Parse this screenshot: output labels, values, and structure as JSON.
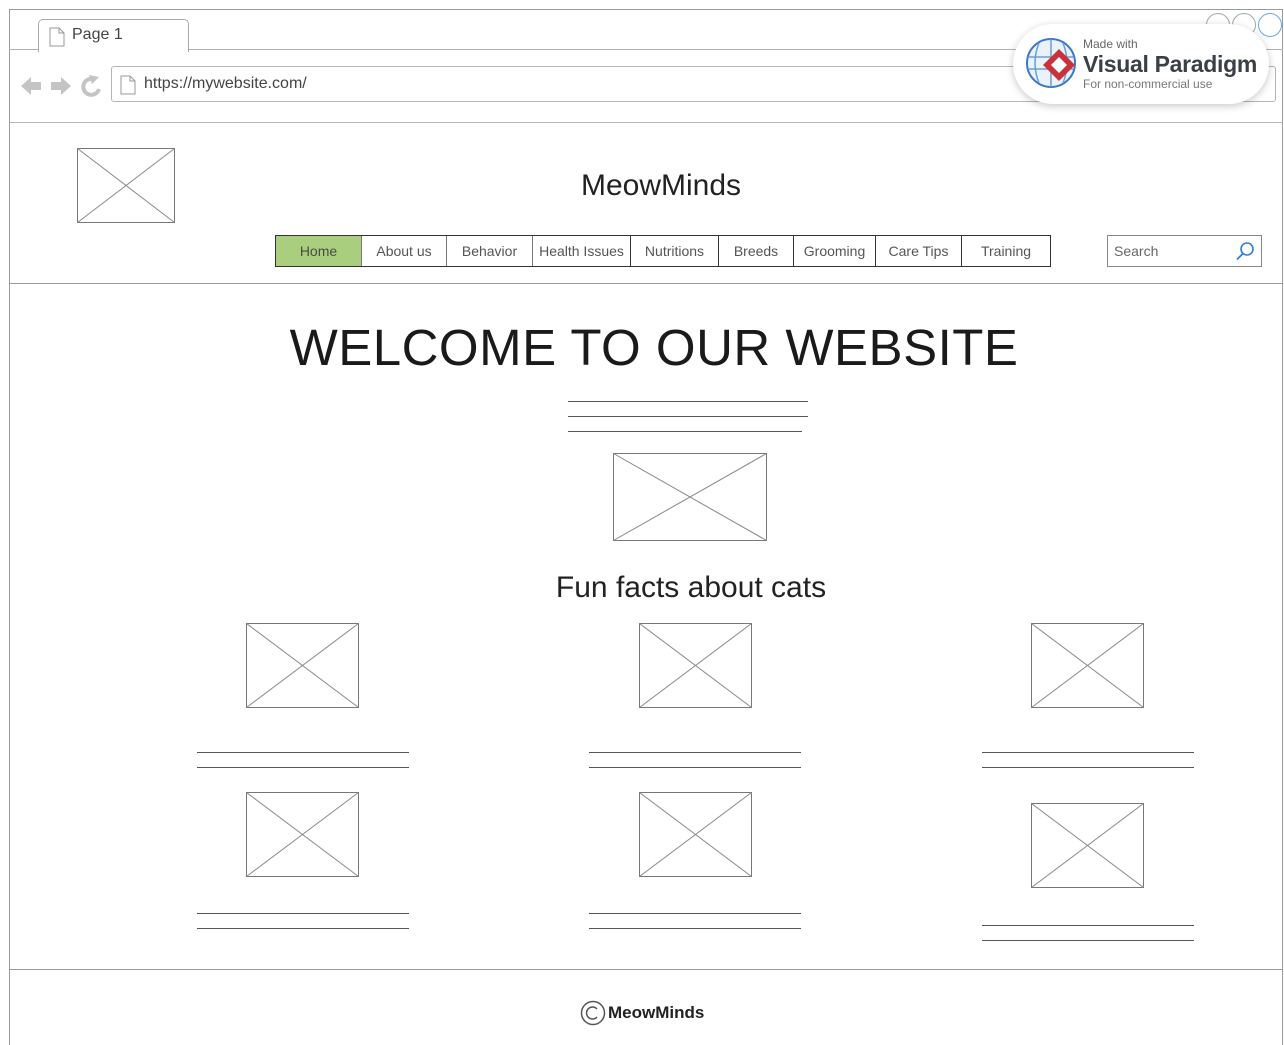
{
  "browser": {
    "tab_label": "Page 1",
    "url": "https://mywebsite.com/"
  },
  "watermark": {
    "made_with": "Made with",
    "brand": "Visual Paradigm",
    "note": "For non-commercial use"
  },
  "site": {
    "title": "MeowMinds"
  },
  "nav": {
    "items": [
      "Home",
      "About us",
      "Behavior",
      "Health Issues",
      "Nutritions",
      "Breeds",
      "Grooming",
      "Care Tips",
      "Training"
    ],
    "active": "Home"
  },
  "search": {
    "placeholder": "Search"
  },
  "hero": {
    "heading": "WELCOME TO OUR WEBSITE"
  },
  "facts": {
    "heading": "Fun facts about cats"
  },
  "footer": {
    "text": "MeowMinds"
  },
  "icons": [
    "page-icon",
    "back-arrow-icon",
    "forward-arrow-icon",
    "reload-icon",
    "search-icon",
    "copyright-icon",
    "globe-logo-icon"
  ],
  "colors": {
    "active_nav": "#a9cf7e",
    "watermark_red": "#c8323a",
    "watermark_blue": "#2f6db5"
  }
}
